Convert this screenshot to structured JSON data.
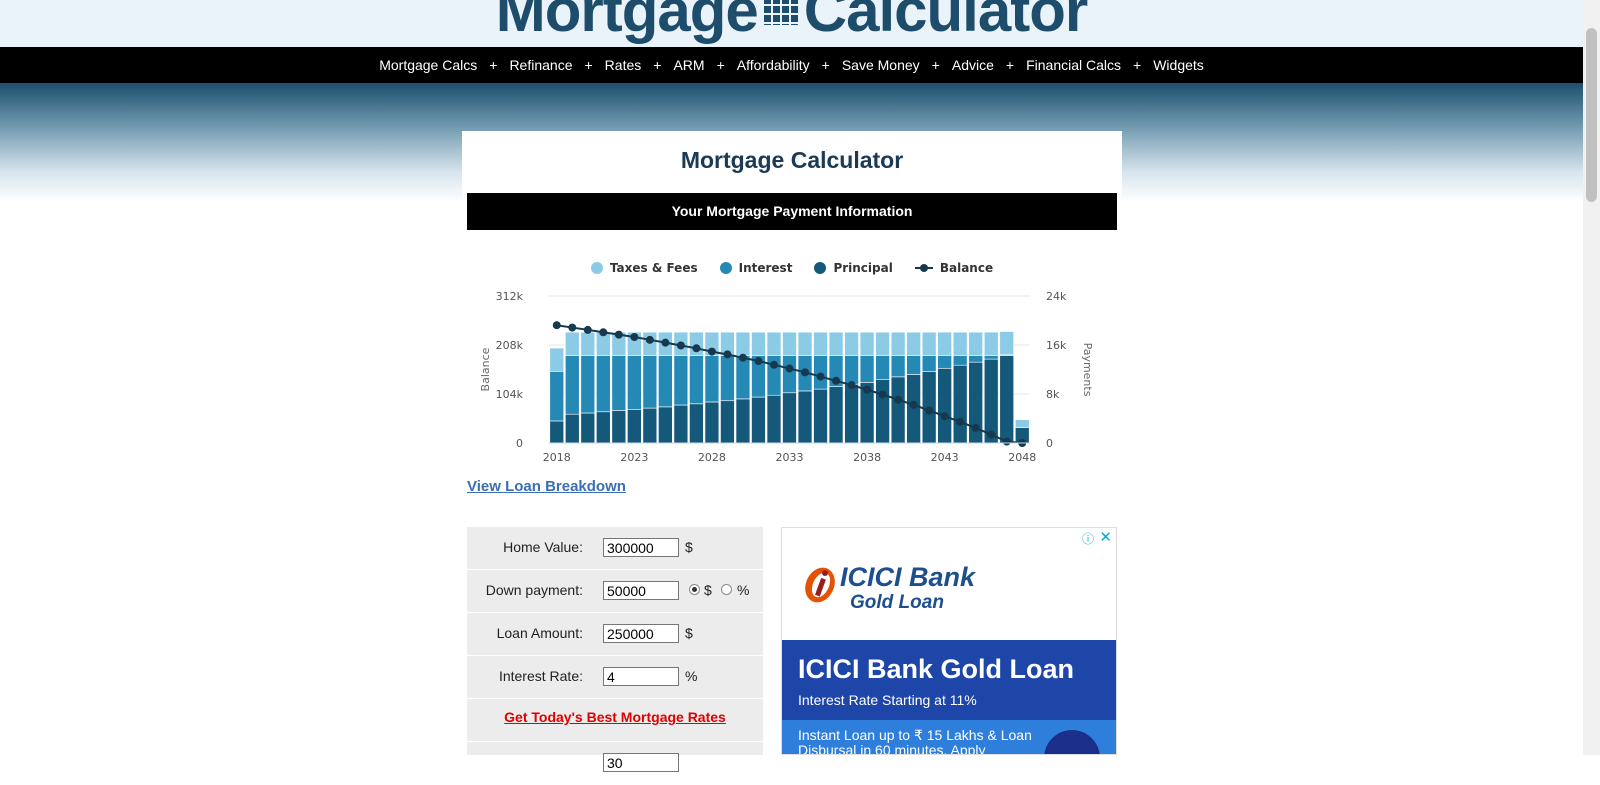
{
  "site": {
    "logo_left": "Mortgage",
    "logo_right": "Calculator"
  },
  "nav": {
    "items": [
      "Mortgage Calcs",
      "Refinance",
      "Rates",
      "ARM",
      "Affordability",
      "Save Money",
      "Advice",
      "Financial Calcs",
      "Widgets"
    ]
  },
  "card": {
    "title": "Mortgage Calculator",
    "info_bar": "Your Mortgage Payment Information"
  },
  "legend": {
    "taxes": "Taxes & Fees",
    "interest": "Interest",
    "principal": "Principal",
    "balance": "Balance"
  },
  "colors": {
    "taxes": "#8ccbe6",
    "interest": "#2589b5",
    "principal": "#14587a",
    "balance": "#16394e",
    "nav_bg": "#000000",
    "link_red": "#e00000",
    "link_blue": "#3a6fb4"
  },
  "links": {
    "view_breakdown": "View Loan Breakdown",
    "best_rates": "Get Today's Best Mortgage Rates"
  },
  "form": {
    "home_value": {
      "label": "Home Value:",
      "value": "300000",
      "unit": "$"
    },
    "down_payment": {
      "label": "Down payment:",
      "value": "50000",
      "unit_dollar": "$",
      "unit_percent": "%",
      "selected": "$"
    },
    "loan_amount": {
      "label": "Loan Amount:",
      "value": "250000",
      "unit": "$"
    },
    "interest_rate": {
      "label": "Interest Rate:",
      "value": "4",
      "unit": "%"
    },
    "loan_term": {
      "value": "30"
    }
  },
  "ad": {
    "info_icon": "info-icon",
    "close_icon": "close-icon",
    "logo_main": "ICICI Bank",
    "logo_sub": "Gold Loan",
    "headline": "ICICI Bank Gold Loan",
    "subline": "Interest Rate Starting at 11%",
    "description": "Instant Loan up to ₹ 15 Lakhs & Loan Disbursal in 60 minutes. Apply"
  },
  "chart_data": {
    "type": "bar",
    "stacked": true,
    "x": [
      2018,
      2019,
      2020,
      2021,
      2022,
      2023,
      2024,
      2025,
      2026,
      2027,
      2028,
      2029,
      2030,
      2031,
      2032,
      2033,
      2034,
      2035,
      2036,
      2037,
      2038,
      2039,
      2040,
      2041,
      2042,
      2043,
      2044,
      2045,
      2046,
      2047,
      2048
    ],
    "x_tick_labels": [
      "2018",
      "2023",
      "2028",
      "2033",
      "2038",
      "2043",
      "2048"
    ],
    "y_left": {
      "label": "Balance",
      "ticks": [
        "0",
        "104k",
        "208k",
        "312k"
      ],
      "ylim": [
        0,
        312000
      ]
    },
    "y_right": {
      "label": "Payments",
      "ticks": [
        "0",
        "8k",
        "16k",
        "24k"
      ],
      "ylim": [
        0,
        24000
      ]
    },
    "series": [
      {
        "name": "Principal",
        "axis": "right",
        "values": [
          3600,
          4700,
          4900,
          5100,
          5300,
          5500,
          5700,
          5900,
          6200,
          6400,
          6700,
          6900,
          7200,
          7500,
          7800,
          8200,
          8500,
          8800,
          9200,
          9600,
          9900,
          10400,
          10800,
          11200,
          11700,
          12200,
          12700,
          13200,
          13700,
          14300,
          2500
        ]
      },
      {
        "name": "Interest",
        "axis": "right",
        "values": [
          8100,
          9600,
          9400,
          9200,
          9000,
          8800,
          8600,
          8400,
          8100,
          7900,
          7600,
          7400,
          7100,
          6800,
          6500,
          6100,
          5800,
          5500,
          5100,
          4700,
          4400,
          3900,
          3500,
          3100,
          2600,
          2100,
          1600,
          1100,
          600,
          100,
          0
        ]
      },
      {
        "name": "Taxes & Fees",
        "axis": "right",
        "values": [
          3800,
          3800,
          3800,
          3800,
          3800,
          3800,
          3800,
          3800,
          3800,
          3800,
          3800,
          3800,
          3800,
          3800,
          3800,
          3800,
          3800,
          3800,
          3800,
          3800,
          3800,
          3800,
          3800,
          3800,
          3800,
          3800,
          3800,
          3800,
          3800,
          3800,
          1300
        ]
      },
      {
        "name": "Balance",
        "type": "line",
        "axis": "left",
        "values": [
          250000,
          245000,
          240000,
          235000,
          230000,
          225000,
          219000,
          213000,
          207000,
          201000,
          194000,
          188000,
          181000,
          174000,
          166000,
          158000,
          150000,
          141000,
          132000,
          123000,
          113000,
          103000,
          92000,
          81000,
          69000,
          57000,
          45000,
          32000,
          18000,
          3000,
          0
        ]
      }
    ],
    "legend_position": "top",
    "grid": true
  }
}
